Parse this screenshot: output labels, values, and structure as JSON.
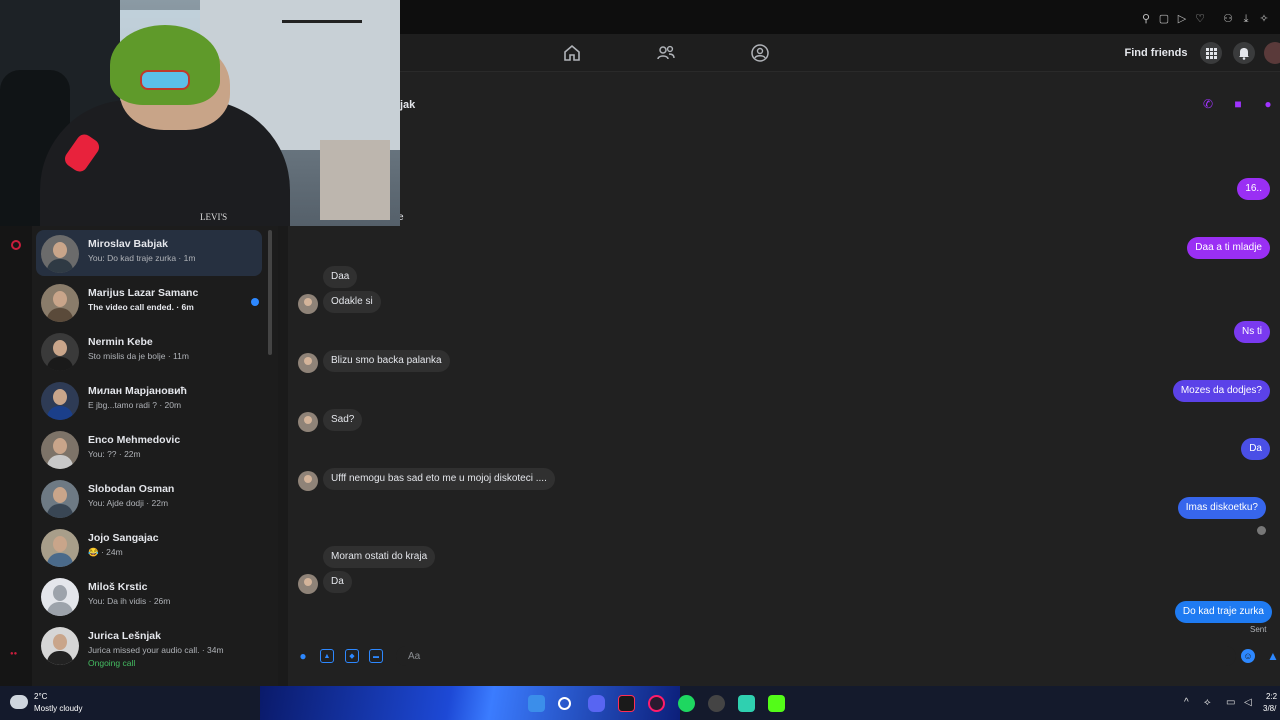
{
  "nav": {
    "find_friends": "Find friends"
  },
  "conversation": {
    "title_fragment": "jak",
    "partial_label": "e",
    "messages": [
      {
        "dir": "out",
        "text": "16..",
        "color": "#9a2ff4"
      },
      {
        "dir": "out",
        "text": "Daa a ti mladje",
        "color": "#9a2ff4"
      },
      {
        "dir": "in",
        "text": "Daa"
      },
      {
        "dir": "in",
        "text": "Odakle si"
      },
      {
        "dir": "out",
        "text": "Ns ti",
        "color": "#7a3af0"
      },
      {
        "dir": "in",
        "text": "Blizu smo backa palanka"
      },
      {
        "dir": "out",
        "text": "Mozes da dodjes?",
        "color": "#5b42e8"
      },
      {
        "dir": "in",
        "text": "Sad?"
      },
      {
        "dir": "out",
        "text": "Da",
        "color": "#4a4fe6"
      },
      {
        "dir": "in",
        "text": "Ufff nemogu bas sad eto me u mojoj diskoteci ...."
      },
      {
        "dir": "out",
        "text": "Imas diskoetku?",
        "color": "#3766ec"
      },
      {
        "dir": "in",
        "text": "Moram ostati do kraja"
      },
      {
        "dir": "in",
        "text": "Da"
      },
      {
        "dir": "out",
        "text": "Do kad traje zurka",
        "color": "#1f7bf2"
      }
    ],
    "status": "Sent"
  },
  "composer": {
    "placeholder": "Aa"
  },
  "chats": [
    {
      "name": "Miroslav Babjak",
      "preview": "You: Do kad traje zurka · 1m",
      "active": true
    },
    {
      "name": "Marijus Lazar Samanc",
      "preview": "The video call ended. · 6m",
      "unread": true
    },
    {
      "name": "Nermin Kebe",
      "preview": "Sto mislis da je bolje · 11m"
    },
    {
      "name": "Милан Марјановић",
      "preview": "E jbg...tamo radi ? · 20m"
    },
    {
      "name": "Enco Mehmedovic",
      "preview": "You: ?? · 22m"
    },
    {
      "name": "Slobodan Osman",
      "preview": "You: Ajde dodji · 22m"
    },
    {
      "name": "Jojo Sangajac",
      "preview": "😂 · 24m"
    },
    {
      "name": "Miloš Krstic",
      "preview": "You: Da ih vidis · 26m"
    },
    {
      "name": "Jurica Lešnjak",
      "preview": "Jurica missed your audio call. · 34m",
      "extra": "Ongoing call"
    }
  ],
  "webcam": {
    "shirt_text": "LEVI'S"
  },
  "taskbar": {
    "temperature": "2°C",
    "weather": "Mostly cloudy",
    "time": "2:2",
    "date": "3/8/"
  }
}
